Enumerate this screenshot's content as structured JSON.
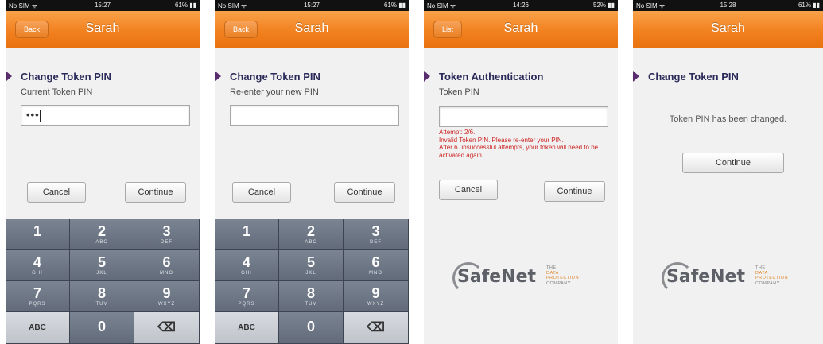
{
  "screens": [
    {
      "status": {
        "carrier": "No SIM ᯤ",
        "time": "15:27",
        "battery": "61% ▮▮"
      },
      "nav": {
        "button": "Back",
        "title": "Sarah"
      },
      "section_title": "Change Token PIN",
      "field_label": "Current Token PIN",
      "pin_value": "•••",
      "buttons": {
        "cancel": "Cancel",
        "continue": "Continue"
      }
    },
    {
      "status": {
        "carrier": "No SIM ᯤ",
        "time": "15:27",
        "battery": "61% ▮▮"
      },
      "nav": {
        "button": "Back",
        "title": "Sarah"
      },
      "section_title": "Change Token PIN",
      "field_label": "Re-enter your new PIN",
      "pin_value": "",
      "buttons": {
        "cancel": "Cancel",
        "continue": "Continue"
      }
    },
    {
      "status": {
        "carrier": "No SIM ᯤ",
        "time": "14:26",
        "battery": "52% ▮▮"
      },
      "nav": {
        "button": "List",
        "title": "Sarah"
      },
      "section_title": "Token Authentication",
      "field_label": "Token PIN",
      "pin_value": "",
      "error": {
        "line1": "Attempt: 2/6.",
        "line2": "Invalid Token PIN. Please re-enter your PIN.",
        "line3": "After 6 unsuccessful attempts, your token will need to be activated again."
      },
      "buttons": {
        "cancel": "Cancel",
        "continue": "Continue"
      },
      "logo": {
        "brand": "SafeNet",
        "tag1": "THE",
        "tag2": "DATA",
        "tag3": "PROTECTION",
        "tag4": "COMPANY"
      }
    },
    {
      "status": {
        "carrier": "No SIM ᯤ",
        "time": "15:28",
        "battery": "61% ▮▮"
      },
      "nav": {
        "title": "Sarah"
      },
      "section_title": "Change Token PIN",
      "message": "Token PIN has been changed.",
      "buttons": {
        "continue": "Continue"
      },
      "logo": {
        "brand": "SafeNet",
        "tag1": "THE",
        "tag2": "DATA",
        "tag3": "PROTECTION",
        "tag4": "COMPANY"
      }
    }
  ],
  "keypad": {
    "keys": [
      {
        "num": "1",
        "letters": ""
      },
      {
        "num": "2",
        "letters": "ABC"
      },
      {
        "num": "3",
        "letters": "DEF"
      },
      {
        "num": "4",
        "letters": "GHI"
      },
      {
        "num": "5",
        "letters": "JKL"
      },
      {
        "num": "6",
        "letters": "MNO"
      },
      {
        "num": "7",
        "letters": "PQRS"
      },
      {
        "num": "8",
        "letters": "TUV"
      },
      {
        "num": "9",
        "letters": "WXYZ"
      }
    ],
    "abc": "ABC",
    "zero": "0",
    "delete_icon": "⌫"
  },
  "colors": {
    "accent": "#f2811f",
    "section_marker": "#5a2d6e",
    "error": "#cc2222"
  }
}
